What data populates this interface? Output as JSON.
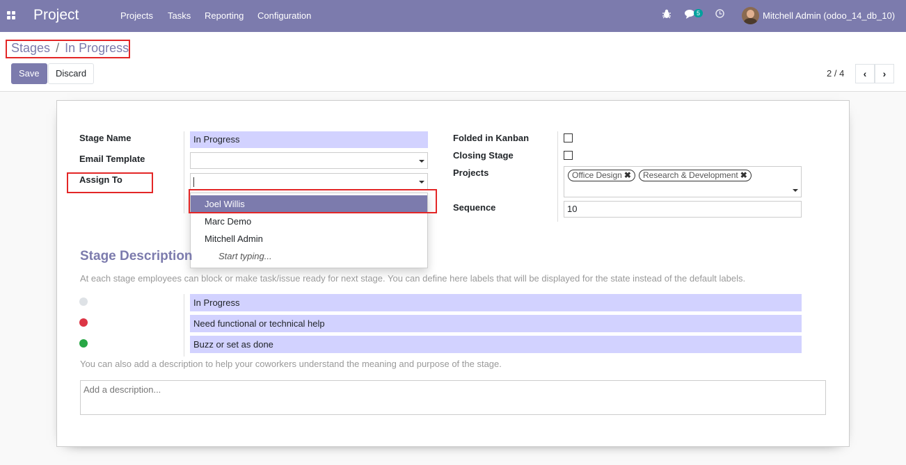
{
  "navbar": {
    "app_title": "Project",
    "menu": [
      "Projects",
      "Tasks",
      "Reporting",
      "Configuration"
    ],
    "messages_count": "5",
    "user": "Mitchell Admin (odoo_14_db_10)"
  },
  "breadcrumb": {
    "parent": "Stages",
    "separator": "/",
    "current": "In Progress"
  },
  "buttons": {
    "save": "Save",
    "discard": "Discard"
  },
  "pager": {
    "value": "2 / 4"
  },
  "form": {
    "stage_name_label": "Stage Name",
    "stage_name_value": "In Progress",
    "email_template_label": "Email Template",
    "email_template_value": "",
    "assign_to_label": "Assign To",
    "assign_to_value": "",
    "folded_label": "Folded in Kanban",
    "folded_checked": false,
    "closing_label": "Closing Stage",
    "closing_checked": false,
    "projects_label": "Projects",
    "projects_tags": [
      "Office Design",
      "Research & Development"
    ],
    "sequence_label": "Sequence",
    "sequence_value": "10"
  },
  "dropdown": {
    "items": [
      "Joel Willis",
      "Marc Demo",
      "Mitchell Admin"
    ],
    "active_index": 0,
    "hint": "Start typing..."
  },
  "stage_description": {
    "title": "Stage Description",
    "help_text": "At each stage employees can block or make task/issue ready for next stage. You can define here labels that will be displayed for the state instead of the default labels.",
    "legends": [
      {
        "color": "#dee2e6",
        "value": "In Progress"
      },
      {
        "color": "#dc3545",
        "value": "Need functional or technical help"
      },
      {
        "color": "#28a745",
        "value": "Buzz or set as done"
      }
    ],
    "extra_help": "You can also add a description to help your coworkers understand the meaning and purpose of the stage.",
    "description_placeholder": "Add a description..."
  }
}
